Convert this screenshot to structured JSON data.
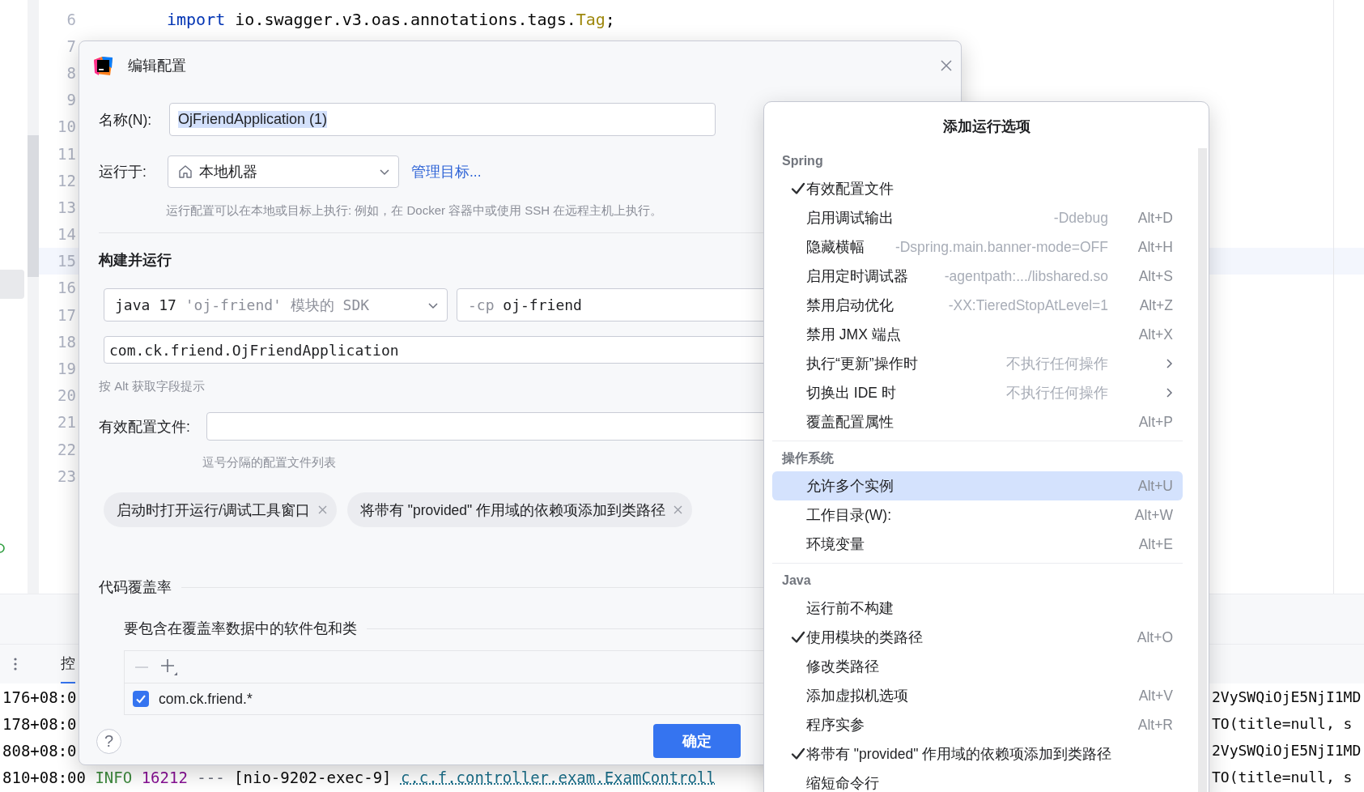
{
  "editor": {
    "lines": [
      {
        "number": "6",
        "current": false,
        "tokens": [
          {
            "text": "import",
            "kind": "keyword"
          },
          {
            "text": "io.swagger.v3.oas.annotations.tags.",
            "kind": "plain"
          },
          {
            "text": "Tag",
            "kind": "type"
          },
          {
            "text": ";",
            "kind": "punct"
          }
        ]
      },
      {
        "number": "7",
        "current": false
      },
      {
        "number": "8",
        "current": false
      },
      {
        "number": "9",
        "current": false
      },
      {
        "number": "10",
        "current": false
      },
      {
        "number": "11",
        "current": false
      },
      {
        "number": "12",
        "current": false
      },
      {
        "number": "13",
        "current": false
      },
      {
        "number": "14",
        "current": false
      },
      {
        "number": "15",
        "current": true
      },
      {
        "number": "16",
        "current": false
      },
      {
        "number": "17",
        "current": false
      },
      {
        "number": "18",
        "current": false
      },
      {
        "number": "19",
        "current": false
      },
      {
        "number": "20",
        "current": false
      },
      {
        "number": "21",
        "current": false
      },
      {
        "number": "22",
        "current": false
      },
      {
        "number": "23",
        "current": false
      }
    ]
  },
  "tool_window": {
    "tab": "控",
    "log_lines": [
      {
        "left": [
          {
            "text": "176+08:0",
            "kind": "time"
          }
        ],
        "right": "2VySWQiOjE5NjI1MD"
      },
      {
        "left": [
          {
            "text": "178+08:0",
            "kind": "time"
          }
        ],
        "right": "TO(title=null, s"
      },
      {
        "left": [
          {
            "text": "808+08:0",
            "kind": "time"
          }
        ],
        "right": "2VySWQiOjE5NjI1MD"
      },
      {
        "left": [
          {
            "text": "810+08:00",
            "kind": "time"
          },
          {
            "text": "INFO",
            "kind": "level"
          },
          {
            "text": "16212",
            "kind": "pid"
          },
          {
            "text": "---",
            "kind": "separator"
          },
          {
            "text": "[nio-9202-exec-9]",
            "kind": "thread"
          },
          {
            "text": "c.c.f.controller.exam.ExamControll",
            "kind": "logger"
          }
        ],
        "right": "TO(title=null, s"
      }
    ]
  },
  "dialog": {
    "title": "编辑配置",
    "name_field": {
      "label": "名称(N):",
      "value": "OjFriendApplication (1)",
      "value_selected": true
    },
    "run_on": {
      "label": "运行于:",
      "value": "本地机器",
      "link": "管理目标...",
      "hint": "运行配置可以在本地或目标上执行: 例如，在 Docker 容器中或使用 SSH 在远程主机上执行。"
    },
    "build_run": {
      "title": "构建并运行",
      "sdk_name": "java 17",
      "sdk_detail": "'oj-friend' 模块的 SDK",
      "classpath_flag": "-cp",
      "classpath_value": "oj-friend",
      "main_class": "com.ck.friend.OjFriendApplication",
      "hint": "按 Alt 获取字段提示"
    },
    "active_profiles": {
      "label": "有效配置文件:",
      "hint": "逗号分隔的配置文件列表"
    },
    "chips": [
      "启动时打开运行/调试工具窗口",
      "将带有 \"provided\" 作用域的依赖项添加到类路径"
    ],
    "coverage": {
      "title": "代码覆盖率",
      "subtitle": "要包含在覆盖率数据中的软件包和类",
      "entries": [
        {
          "pattern": "com.ck.friend.*",
          "checked": true
        }
      ]
    },
    "help_button": "?",
    "ok_button": "确定"
  },
  "popup": {
    "title": "添加运行选项",
    "sections": [
      {
        "title": "Spring",
        "items": [
          {
            "label": "有效配置文件",
            "kind": "action",
            "checked": true,
            "selected": false
          },
          {
            "label": "启用调试输出",
            "detail": "-Ddebug",
            "shortcut": "Alt+D",
            "kind": "action",
            "checked": false,
            "selected": false
          },
          {
            "label": "隐藏横幅",
            "detail": "-Dspring.main.banner-mode=OFF",
            "shortcut": "Alt+H",
            "kind": "action",
            "checked": false,
            "selected": false
          },
          {
            "label": "启用定时调试器",
            "detail": "-agentpath:.../libshared.so",
            "shortcut": "Alt+S",
            "kind": "action",
            "checked": false,
            "selected": false
          },
          {
            "label": "禁用启动优化",
            "detail": "-XX:TieredStopAtLevel=1",
            "shortcut": "Alt+Z",
            "kind": "action",
            "checked": false,
            "selected": false
          },
          {
            "label": "禁用 JMX 端点",
            "shortcut": "Alt+X",
            "kind": "action",
            "checked": false,
            "selected": false
          },
          {
            "label": "执行“更新”操作时",
            "detail": "不执行任何操作",
            "kind": "submenu",
            "checked": false,
            "selected": false
          },
          {
            "label": "切换出 IDE 时",
            "detail": "不执行任何操作",
            "kind": "submenu",
            "checked": false,
            "selected": false
          },
          {
            "label": "覆盖配置属性",
            "shortcut": "Alt+P",
            "kind": "action",
            "checked": false,
            "selected": false
          }
        ]
      },
      {
        "title": "操作系统",
        "items": [
          {
            "label": "允许多个实例",
            "shortcut": "Alt+U",
            "kind": "action",
            "checked": false,
            "selected": true
          },
          {
            "label": "工作目录(W):",
            "shortcut": "Alt+W",
            "kind": "action",
            "checked": false,
            "selected": false
          },
          {
            "label": "环境变量",
            "shortcut": "Alt+E",
            "kind": "action",
            "checked": false,
            "selected": false
          }
        ]
      },
      {
        "title": "Java",
        "items": [
          {
            "label": "运行前不构建",
            "kind": "action",
            "checked": false,
            "selected": false
          },
          {
            "label": "使用模块的类路径",
            "shortcut": "Alt+O",
            "kind": "action",
            "checked": true,
            "selected": false
          },
          {
            "label": "修改类路径",
            "kind": "action",
            "checked": false,
            "selected": false
          },
          {
            "label": "添加虚拟机选项",
            "shortcut": "Alt+V",
            "kind": "action",
            "checked": false,
            "selected": false
          },
          {
            "label": "程序实参",
            "shortcut": "Alt+R",
            "kind": "action",
            "checked": false,
            "selected": false
          },
          {
            "label": "将带有 \"provided\" 作用域的依赖项添加到类路径",
            "kind": "action",
            "checked": true,
            "selected": false
          },
          {
            "label": "缩短命令行",
            "kind": "action",
            "checked": false,
            "selected": false
          }
        ]
      }
    ]
  }
}
